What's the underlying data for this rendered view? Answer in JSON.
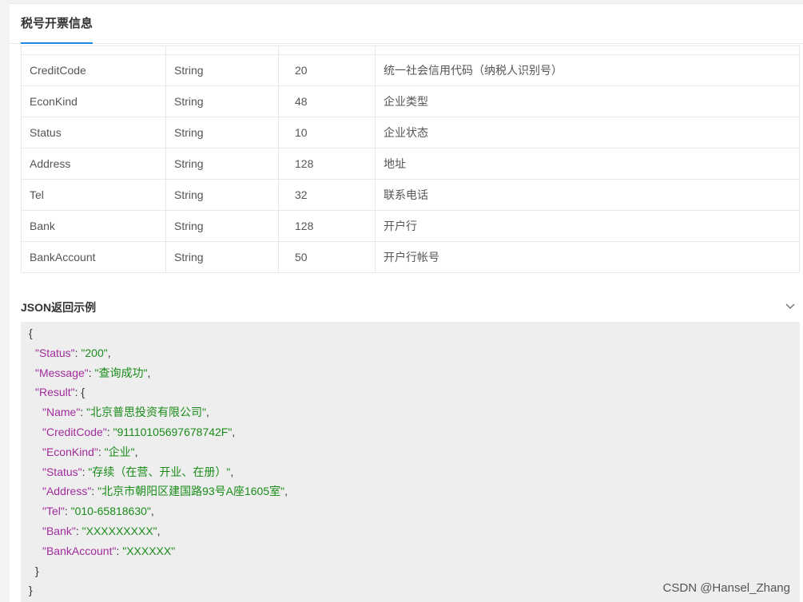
{
  "tab": {
    "label": "税号开票信息"
  },
  "table": {
    "rows": [
      [
        "CreditCode",
        "String",
        "20",
        "统一社会信用代码（纳税人识别号）"
      ],
      [
        "EconKind",
        "String",
        "48",
        "企业类型"
      ],
      [
        "Status",
        "String",
        "10",
        "企业状态"
      ],
      [
        "Address",
        "String",
        "128",
        "地址"
      ],
      [
        "Tel",
        "String",
        "32",
        "联系电话"
      ],
      [
        "Bank",
        "String",
        "128",
        "开户行"
      ],
      [
        "BankAccount",
        "String",
        "50",
        "开户行帐号"
      ]
    ]
  },
  "json_section": {
    "title": "JSON返回示例",
    "icon": "chevron-down-icon",
    "lines": [
      {
        "indent": 0,
        "text": "{"
      },
      {
        "indent": 1,
        "key": "\"Status\"",
        "value": "\"200\"",
        "tail": ","
      },
      {
        "indent": 1,
        "key": "\"Message\"",
        "value": "\"查询成功\"",
        "tail": ","
      },
      {
        "indent": 1,
        "key": "\"Result\"",
        "text_after": ": {"
      },
      {
        "indent": 2,
        "key": "\"Name\"",
        "value": "\"北京普思投资有限公司\"",
        "tail": ","
      },
      {
        "indent": 2,
        "key": "\"CreditCode\"",
        "value": "\"91110105697678742F\"",
        "tail": ","
      },
      {
        "indent": 2,
        "key": "\"EconKind\"",
        "value": "\"企业\"",
        "tail": ","
      },
      {
        "indent": 2,
        "key": "\"Status\"",
        "value": "\"存续（在营、开业、在册）\"",
        "tail": ","
      },
      {
        "indent": 2,
        "key": "\"Address\"",
        "value": "\"北京市朝阳区建国路93号A座1605室\"",
        "tail": ","
      },
      {
        "indent": 2,
        "key": "\"Tel\"",
        "value": "\"010-65818630\"",
        "tail": ","
      },
      {
        "indent": 2,
        "key": "\"Bank\"",
        "value": "\"XXXXXXXXX\"",
        "tail": ","
      },
      {
        "indent": 2,
        "key": "\"BankAccount\"",
        "value": "\"XXXXXX\"",
        "tail": ""
      },
      {
        "indent": 1,
        "text": "}"
      },
      {
        "indent": 0,
        "text": "}"
      }
    ]
  },
  "watermark": "CSDN @Hansel_Zhang",
  "colors": {
    "key": "#a12c9c",
    "string": "#198c19",
    "tab_accent": "#1e88e5"
  }
}
